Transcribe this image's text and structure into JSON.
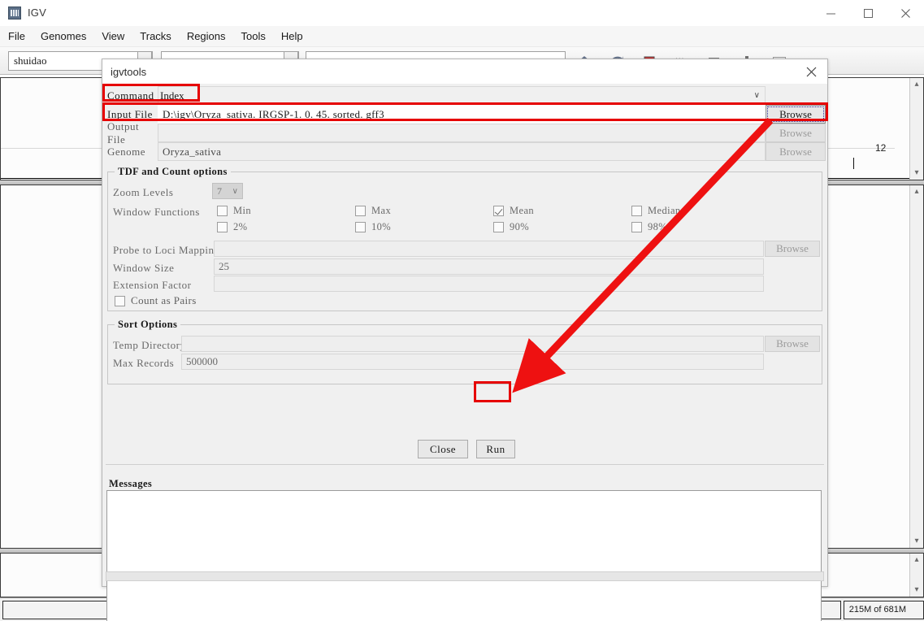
{
  "window": {
    "title": "IGV",
    "app_icon": "igv-app-icon",
    "minimize_label": "minimize-icon",
    "maximize_label": "maximize-icon",
    "close_label": "close-icon"
  },
  "menubar": {
    "items": [
      {
        "label": "File"
      },
      {
        "label": "Genomes"
      },
      {
        "label": "View"
      },
      {
        "label": "Tracks"
      },
      {
        "label": "Regions"
      },
      {
        "label": "Tools"
      },
      {
        "label": "Help"
      }
    ]
  },
  "toolbar": {
    "genome_value": "shuidao",
    "chromosome_value": "",
    "locus_value": "",
    "add_panel_label": "+"
  },
  "background": {
    "track_number": "12"
  },
  "dialog": {
    "title": "igvtools",
    "close_label": "✕",
    "command": {
      "label": "Command",
      "value": "Index",
      "caret": "∨"
    },
    "input_file": {
      "label": "Input File",
      "value": "D:\\igv\\Oryza_sativa. IRGSP-1. 0. 45. sorted. gff3",
      "browse_label": "Browse"
    },
    "output_file": {
      "label": "Output File",
      "value": "",
      "browse_label": "Browse"
    },
    "genome": {
      "label": "Genome",
      "value": "Oryza_sativa",
      "browse_label": "Browse"
    },
    "tdf_group": {
      "title": "TDF and Count options",
      "zoom_levels": {
        "label": "Zoom Levels",
        "value": "7",
        "caret": "∨"
      },
      "window_functions": {
        "label": "Window Functions",
        "checkboxes": [
          {
            "label": "Min",
            "checked": false
          },
          {
            "label": "Max",
            "checked": false
          },
          {
            "label": "Mean",
            "checked": true
          },
          {
            "label": "Median",
            "checked": false
          },
          {
            "label": "2%",
            "checked": false
          },
          {
            "label": "10%",
            "checked": false
          },
          {
            "label": "90%",
            "checked": false
          },
          {
            "label": "98%",
            "checked": false
          }
        ]
      },
      "probe_to_loci": {
        "label": "Probe to Loci Mapping",
        "value": "",
        "browse_label": "Browse"
      },
      "window_size": {
        "label": "Window Size",
        "value": "25"
      },
      "extension_factor": {
        "label": "Extension Factor",
        "value": ""
      },
      "count_as_pairs": {
        "label": "Count as Pairs",
        "checked": false
      }
    },
    "sort_group": {
      "title": "Sort Options",
      "temp_directory": {
        "label": "Temp Directory",
        "value": "",
        "browse_label": "Browse"
      },
      "max_records": {
        "label": "Max Records",
        "value": "500000"
      }
    },
    "buttons": {
      "close_label": "Close",
      "run_label": "Run"
    },
    "messages": {
      "label": "Messages",
      "value": ""
    }
  },
  "statusbar": {
    "left_cell": "",
    "mid_cell": "",
    "right_cell": "",
    "memory": "215M of 681M"
  },
  "annotations": {
    "highlight_color": "#e60000",
    "arrow_color": "#ee1111",
    "arrow_from": "browse-button",
    "arrow_to": "run-button"
  }
}
